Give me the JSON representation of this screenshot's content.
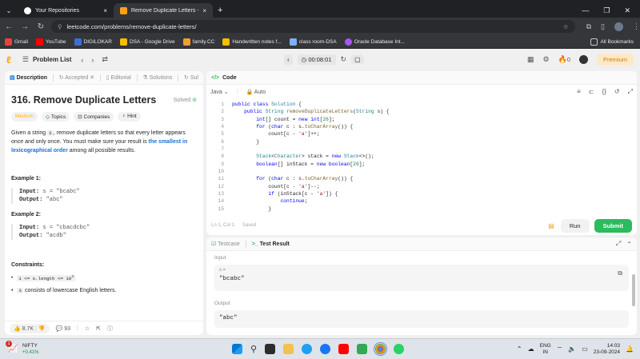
{
  "browser": {
    "tabs": [
      {
        "title": "Your Repositories",
        "active": false
      },
      {
        "title": "Remove Duplicate Letters - Lee",
        "active": true
      }
    ],
    "url": "leetcode.com/problems/remove-duplicate-letters/",
    "bookmarks": [
      "Gmail",
      "YouTube",
      "DIGILOKAR",
      "DSA - Google Drive",
      "family.CC",
      "Handwritten notes f...",
      "class room-DSA",
      "Oracle Database Int..."
    ],
    "all_bookmarks": "All Bookmarks"
  },
  "header": {
    "problem_list": "Problem List",
    "timer": "00:08:01",
    "streak": "0",
    "premium": "Premium"
  },
  "description": {
    "tabs": [
      "Description",
      "Accepted",
      "Editorial",
      "Solutions",
      "Sul"
    ],
    "title": "316. Remove Duplicate Letters",
    "solved": "Solved",
    "difficulty": "Medium",
    "tags": [
      "Topics",
      "Companies",
      "Hint"
    ],
    "text_1": "Given a string ",
    "code_s": "s",
    "text_2": ", remove duplicate letters so that every letter appears once and only once. You must make sure your result is ",
    "text_bold": "the smallest in lexicographical order",
    "text_3": " among all possible results.",
    "example1_label": "Example 1:",
    "example1_input_label": "Input:",
    "example1_input": "s = \"bcabc\"",
    "example1_output_label": "Output:",
    "example1_output": "\"abc\"",
    "example2_label": "Example 2:",
    "example2_input_label": "Input:",
    "example2_input": "s = \"cbacdcbc\"",
    "example2_output_label": "Output:",
    "example2_output": "\"acdb\"",
    "constraints_label": "Constraints:",
    "constraint1": "1 <= s.length <= 10",
    "constraint1_sup": "4",
    "constraint2_code": "s",
    "constraint2": " consists of lowercase English letters.",
    "likes": "8.7K",
    "comments": "93"
  },
  "code": {
    "title": "Code",
    "language": "Java",
    "autocomplete": "Auto",
    "status": "Ln 1, Col 1",
    "saved": "Saved",
    "run": "Run",
    "submit": "Submit",
    "lines": [
      "public class Solution {",
      "    public String removeDuplicateLetters(String s) {",
      "        int[] count = new int[26];",
      "        for (char c : s.toCharArray()) {",
      "            count[c - 'a']++;",
      "        }",
      "",
      "        Stack<Character> stack = new Stack<>();",
      "        boolean[] inStack = new boolean[26];",
      "",
      "        for (char c : s.toCharArray()) {",
      "            count[c - 'a']--;",
      "            if (inStack[c - 'a']) {",
      "                continue;",
      "            }"
    ]
  },
  "test": {
    "tabs": [
      "Testcase",
      "Test Result"
    ],
    "input_label": "Input",
    "var_label": "s =",
    "input_value": "\"bcabc\"",
    "output_label": "Output",
    "output_value": "\"abc\""
  },
  "taskbar": {
    "nifty": "NIFTY",
    "nifty_change": "+0.41%",
    "notif": "1",
    "lang": "ENG",
    "region": "IN",
    "time": "14:03",
    "date": "23-09-2024"
  }
}
